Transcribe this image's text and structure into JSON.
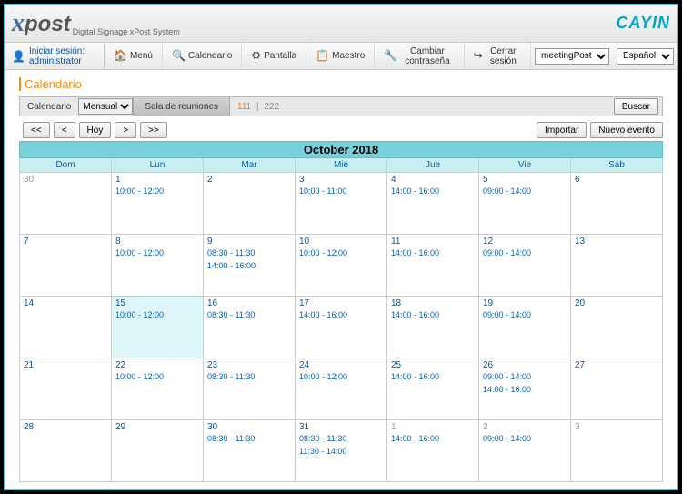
{
  "header": {
    "logo_x": "x",
    "logo_post": "post",
    "subtitle": "Digital Signage xPost System",
    "brand": "CAYIN"
  },
  "toolbar": {
    "login_label": "Iniciar sesión:",
    "username": "administrator",
    "items": {
      "menu": "Menú",
      "calendario": "Calendario",
      "pantalla": "Pantalla",
      "maestro": "Maestro",
      "cambiar_pass": "Cambiar contraseña",
      "cerrar": "Cerrar sesión"
    },
    "module_select": "meetingPost",
    "lang_select": "Español"
  },
  "page": {
    "title": "Calendario",
    "filter": {
      "cal_label": "Calendario",
      "view": "Mensual",
      "room_tab": "Sala de reuniones",
      "room_active": "111",
      "room_other": "222",
      "search": "Buscar"
    },
    "nav": {
      "first": "<<",
      "prev": "<",
      "today": "Hoy",
      "next": ">",
      "last": ">>",
      "import": "Importar",
      "new_event": "Nuevo evento"
    }
  },
  "calendar": {
    "month_title": "October 2018",
    "dow": [
      "Dom",
      "Lun",
      "Mar",
      "Mié",
      "Jue",
      "Vie",
      "Sáb"
    ],
    "weeks": [
      [
        {
          "n": "30",
          "out": true,
          "events": []
        },
        {
          "n": "1",
          "events": [
            "10:00 - 12:00"
          ]
        },
        {
          "n": "2",
          "events": []
        },
        {
          "n": "3",
          "events": [
            "10:00 - 11:00"
          ]
        },
        {
          "n": "4",
          "events": [
            "14:00 - 16:00"
          ]
        },
        {
          "n": "5",
          "events": [
            "09:00 - 14:00"
          ]
        },
        {
          "n": "6",
          "events": []
        }
      ],
      [
        {
          "n": "7",
          "events": []
        },
        {
          "n": "8",
          "events": [
            "10:00 - 12:00"
          ]
        },
        {
          "n": "9",
          "events": [
            "08:30 - 11:30",
            "14:00 - 16:00"
          ]
        },
        {
          "n": "10",
          "events": [
            "10:00 - 12:00"
          ]
        },
        {
          "n": "11",
          "events": [
            "14:00 - 16:00"
          ]
        },
        {
          "n": "12",
          "events": [
            "09:00 - 14:00"
          ]
        },
        {
          "n": "13",
          "events": []
        }
      ],
      [
        {
          "n": "14",
          "events": []
        },
        {
          "n": "15",
          "today": true,
          "events": [
            "10:00 - 12:00"
          ]
        },
        {
          "n": "16",
          "events": [
            "08:30 - 11:30"
          ]
        },
        {
          "n": "17",
          "events": [
            "14:00 - 16:00"
          ]
        },
        {
          "n": "18",
          "events": [
            "14:00 - 16:00"
          ]
        },
        {
          "n": "19",
          "events": [
            "09:00 - 14:00"
          ]
        },
        {
          "n": "20",
          "events": []
        }
      ],
      [
        {
          "n": "21",
          "events": []
        },
        {
          "n": "22",
          "events": [
            "10:00 - 12:00"
          ]
        },
        {
          "n": "23",
          "events": [
            "08:30 - 11:30"
          ]
        },
        {
          "n": "24",
          "events": [
            "10:00 - 12:00"
          ]
        },
        {
          "n": "25",
          "events": [
            "14:00 - 16:00"
          ]
        },
        {
          "n": "26",
          "events": [
            "09:00 - 14:00",
            "14:00 - 16:00"
          ]
        },
        {
          "n": "27",
          "events": []
        }
      ],
      [
        {
          "n": "28",
          "events": []
        },
        {
          "n": "29",
          "events": []
        },
        {
          "n": "30",
          "events": [
            "08:30 - 11:30"
          ]
        },
        {
          "n": "31",
          "events": [
            "08:30 - 11:30",
            "11:30 - 14:00"
          ]
        },
        {
          "n": "1",
          "out": true,
          "events": [
            "14:00 - 16:00"
          ]
        },
        {
          "n": "2",
          "out": true,
          "events": [
            "09:00 - 14:00"
          ]
        },
        {
          "n": "3",
          "out": true,
          "events": []
        }
      ]
    ]
  }
}
